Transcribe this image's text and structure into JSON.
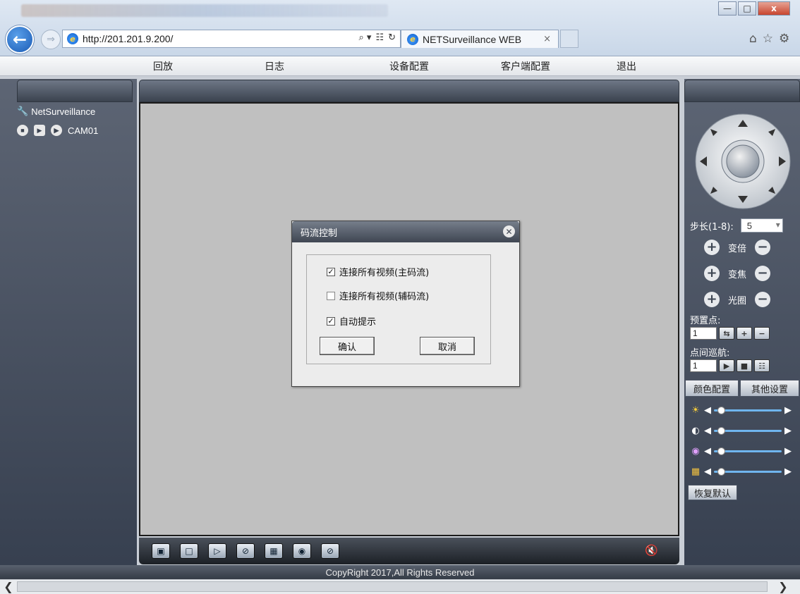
{
  "browser": {
    "address": "http://201.201.9.200/",
    "tab_title": "NETSurveillance WEB",
    "tab_close": "×",
    "back_icon": "back-arrow-icon",
    "forward_icon": "forward-arrow-icon",
    "window_buttons": {
      "minimize": "—",
      "maximize": "□",
      "close": "x"
    },
    "address_tools": [
      "⌕ ▾",
      "☷",
      "↻"
    ],
    "right_tools": [
      "⌂",
      "☆",
      "⚙"
    ]
  },
  "nav": {
    "items": [
      "回放",
      "日志",
      "设备配置",
      "客户端配置",
      "退出"
    ]
  },
  "tree": {
    "root": "NetSurveillance",
    "camera": "CAM01"
  },
  "dialog": {
    "title": "码流控制",
    "close": "✕",
    "options": [
      {
        "label": "连接所有视频(主码流)",
        "checked": true
      },
      {
        "label": "连接所有视频(辅码流)",
        "checked": false
      },
      {
        "label": "自动提示",
        "checked": true
      }
    ],
    "confirm": "确认",
    "cancel": "取消"
  },
  "ptz": {
    "step_label": "步长(1-8):",
    "step_value": "5",
    "zoom_label": "变倍",
    "focus_label": "变焦",
    "iris_label": "光圈",
    "preset_label": "预置点:",
    "preset_value": "1",
    "cruise_label": "点间巡航:",
    "cruise_value": "1"
  },
  "settings_tabs": [
    "颜色配置",
    "其他设置"
  ],
  "color_sliders": [
    {
      "icon": "brightness-icon",
      "level": 0.1
    },
    {
      "icon": "contrast-icon",
      "level": 0.1
    },
    {
      "icon": "saturation-icon",
      "level": 0.1
    },
    {
      "icon": "hue-icon",
      "level": 0.1
    }
  ],
  "restore_label": "恢复默认",
  "footer": "CopyRight 2017,All Rights Reserved",
  "colors": {
    "panel_dark": "#374050",
    "slider_track": "#6fb5ee",
    "video_bg": "#c0c0c0"
  }
}
